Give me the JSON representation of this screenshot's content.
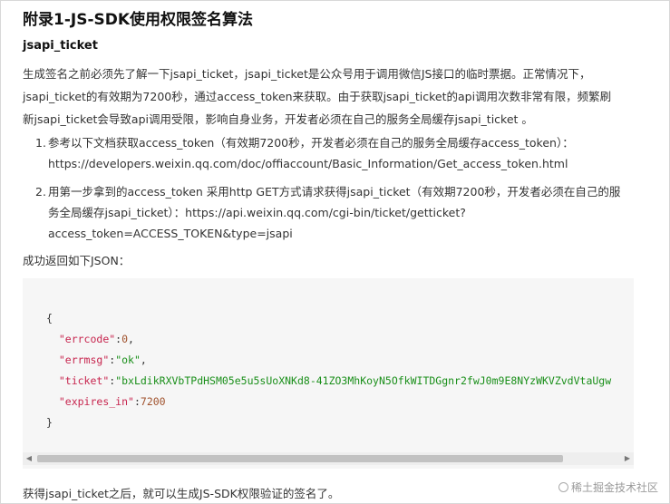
{
  "title": "附录1-JS-SDK使用权限签名算法",
  "subtitle": "jsapi_ticket",
  "intro": [
    "生成签名之前必须先了解一下jsapi_ticket，jsapi_ticket是公众号用于调用微信JS接口的临时票据。正常情况下，",
    "jsapi_ticket的有效期为7200秒，通过access_token来获取。由于获取jsapi_ticket的api调用次数非常有限，频繁刷",
    "新jsapi_ticket会导致api调用受限，影响自身业务，开发者必须在自己的服务全局缓存jsapi_ticket 。"
  ],
  "steps": [
    {
      "num": "1.",
      "lines": [
        "参考以下文档获取access_token（有效期7200秒，开发者必须在自己的服务全局缓存access_token）：",
        "https://developers.weixin.qq.com/doc/offiaccount/Basic_Information/Get_access_token.html"
      ]
    },
    {
      "num": "2.",
      "lines": [
        "用第一步拿到的access_token 采用http GET方式请求获得jsapi_ticket（有效期7200秒，开发者必须在自己的服",
        "务全局缓存jsapi_ticket）：https://api.weixin.qq.com/cgi-bin/ticket/getticket?",
        "access_token=ACCESS_TOKEN&type=jsapi"
      ]
    }
  ],
  "success_text": "成功返回如下JSON：",
  "code": {
    "open_brace": "{",
    "close_brace": "}",
    "errcode_key": "\"errcode\"",
    "errcode_val": "0",
    "errmsg_key": "\"errmsg\"",
    "errmsg_val": "\"ok\"",
    "ticket_key": "\"ticket\"",
    "ticket_val": "\"bxLdikRXVbTPdHSM05e5u5sUoXNKd8-41ZO3MhKoyN5OfkWITDGgnr2fwJ0m9E8NYzWKVZvdVtaUgw",
    "expires_key": "\"expires_in\"",
    "expires_val": "7200"
  },
  "scrollbar": {
    "left_arrow": "◀",
    "right_arrow": "▶"
  },
  "footer_text": "获得jsapi_ticket之后，就可以生成JS-SDK权限验证的签名了。",
  "watermark": "稀土掘金技术社区",
  "colors": {
    "code_bg": "#f6f6f6",
    "json_key": "#c7254e",
    "json_string": "#1a8f1a"
  }
}
